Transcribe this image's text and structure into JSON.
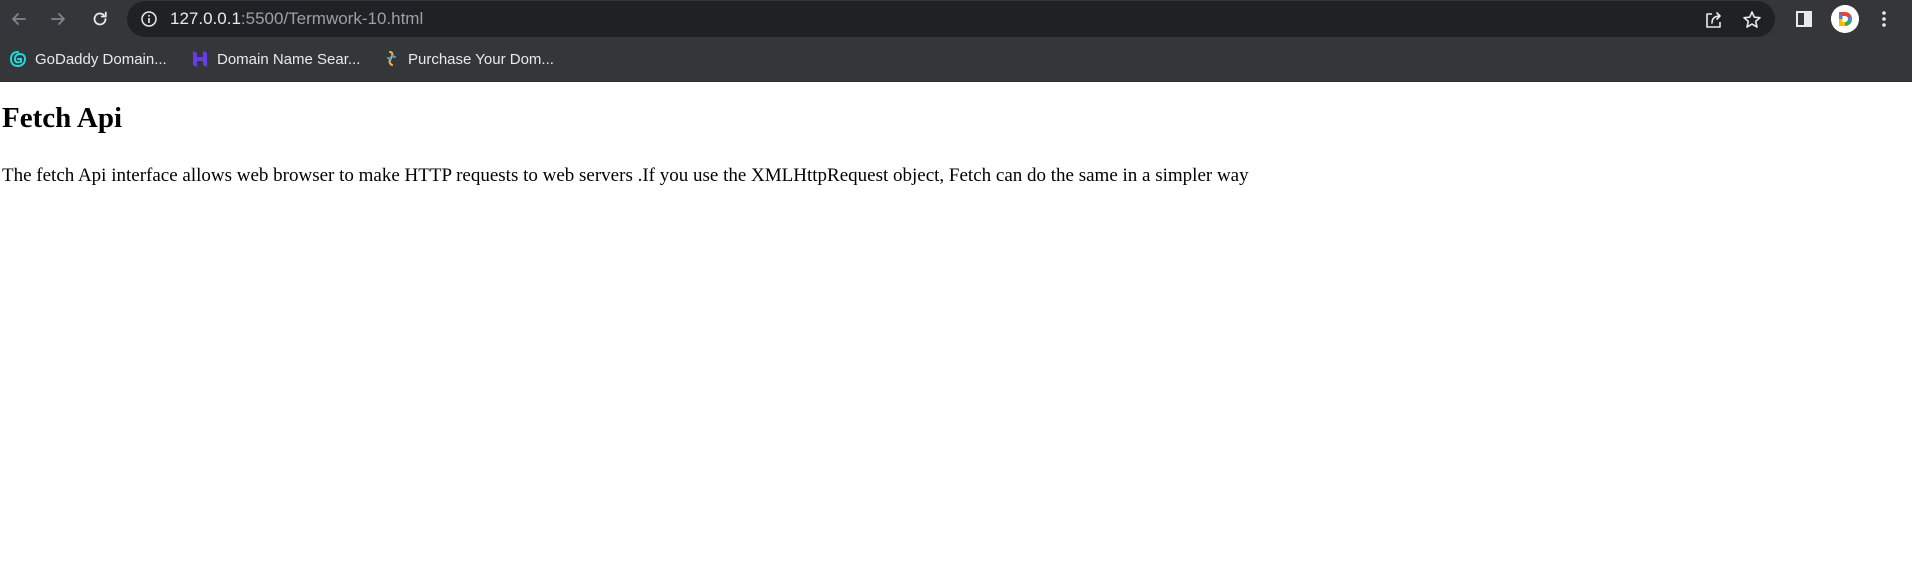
{
  "browser": {
    "url_host": "127.0.0.1",
    "url_rest": ":5500/Termwork-10.html",
    "avatar_letter": "D"
  },
  "bookmarks": [
    {
      "label": "GoDaddy Domain...",
      "icon": "godaddy-icon"
    },
    {
      "label": "Domain Name Sear...",
      "icon": "hostinger-icon"
    },
    {
      "label": "Purchase Your Dom...",
      "icon": "domain-bird-icon"
    }
  ],
  "page": {
    "heading": "Fetch Api",
    "paragraph": "The fetch Api interface allows web browser to make HTTP requests to web servers .If you use the XMLHttpRequest object, Fetch can do the same in a simpler way"
  },
  "colors": {
    "toolbar_bg": "#35363a",
    "omnibox_bg": "#202124",
    "page_bg": "#ffffff"
  }
}
